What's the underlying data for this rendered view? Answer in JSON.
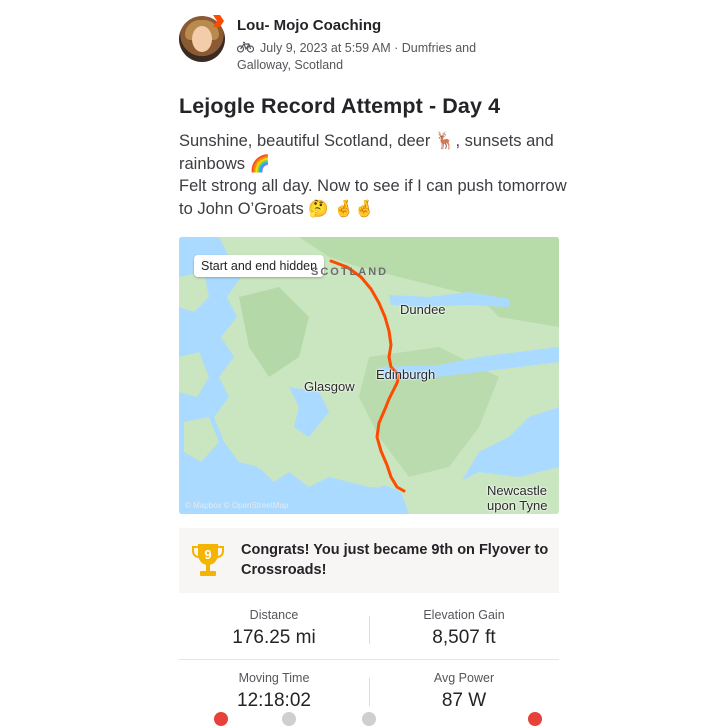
{
  "post": {
    "author": "Lou- Mojo Coaching",
    "meta": "July 9, 2023 at 5:59 AM · Dumfries and Galloway, Scotland",
    "title": "Lejogle Record Attempt - Day 4",
    "description": "Sunshine, beautiful Scotland, deer 🦌, sunsets and rainbows 🌈\nFelt strong all day. Now to see if I can push tomorrow to John O’Groats 🤔 🤞🤞"
  },
  "map": {
    "privacy_label": "Start and end hidden",
    "region_label": "SCOTLAND",
    "cities": {
      "dundee": "Dundee",
      "glasgow": "Glasgow",
      "edinburgh": "Edinburgh",
      "newcastle": "Newcastle upon Tyne"
    },
    "attribution": "© Mapbox © OpenStreetMap",
    "route_color": "#fc4c02"
  },
  "achievement": {
    "rank": "9",
    "text": "Congrats! You just became 9th on Flyover to Crossroads!"
  },
  "stats": {
    "distance": {
      "label": "Distance",
      "value": "176.25 mi"
    },
    "elevation": {
      "label": "Elevation Gain",
      "value": "8,507 ft"
    },
    "moving_time": {
      "label": "Moving Time",
      "value": "12:18:02"
    },
    "avg_power": {
      "label": "Avg Power",
      "value": "87 W"
    }
  },
  "icons": {
    "activity_type": "bike-icon",
    "achievement": "trophy-icon"
  }
}
